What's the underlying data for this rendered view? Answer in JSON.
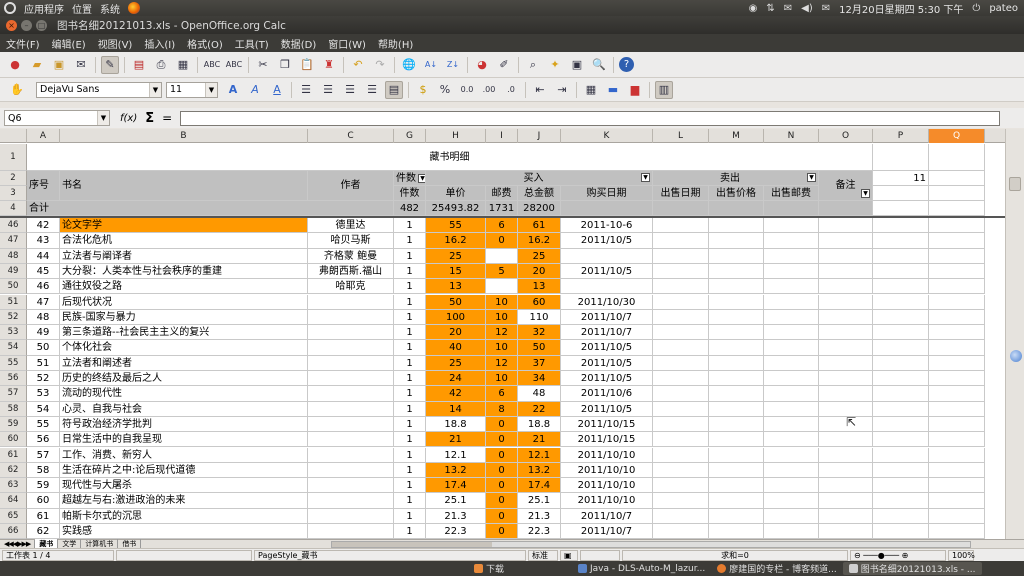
{
  "top_panel": {
    "menus": [
      "应用程序",
      "位置",
      "系统"
    ],
    "datetime": "12月20日星期四 5:30 下午",
    "user": "pateo"
  },
  "window": {
    "title": "图书名细20121013.xls - OpenOffice.org Calc"
  },
  "menubar": [
    "文件(F)",
    "编辑(E)",
    "视图(V)",
    "插入(I)",
    "格式(O)",
    "工具(T)",
    "数据(D)",
    "窗口(W)",
    "帮助(H)"
  ],
  "format_bar": {
    "font_name": "DejaVu Sans",
    "font_size": "11"
  },
  "formula_bar": {
    "cell_ref": "Q6",
    "fx": "f(x)",
    "sigma": "Σ",
    "eq": "=",
    "content": ""
  },
  "columns": [
    "A",
    "B",
    "C",
    "G",
    "H",
    "I",
    "J",
    "K",
    "L",
    "M",
    "N",
    "O",
    "P",
    "Q"
  ],
  "selected_column": "Q",
  "header": {
    "title": "藏书明细",
    "p2_value": "11",
    "seq": "序号",
    "book": "书名",
    "author": "作者",
    "count_label": "件数",
    "buy_label": "买入",
    "sell_label": "卖出",
    "note": "备注",
    "count_sub": "件数",
    "unit_price": "单价",
    "postage": "邮费",
    "total": "总金额",
    "buy_date": "购买日期",
    "sell_date": "出售日期",
    "sell_price": "出售价格",
    "sell_postage": "出售邮费",
    "sum_label": "合计",
    "sum_count": "482",
    "sum_price": "25493.82",
    "sum_postage": "1731",
    "sum_total": "28200"
  },
  "rows": [
    {
      "r": "46",
      "seq": "42",
      "title": "论文字学",
      "author": "德里达",
      "qty": "1",
      "price": "55",
      "post": "6",
      "total": "61",
      "date": "2011-10-6",
      "titleOrg": true,
      "priceOrg": true,
      "postOrg": true,
      "totalOrg": true
    },
    {
      "r": "47",
      "seq": "43",
      "title": "合法化危机",
      "author": "哈贝马斯",
      "qty": "1",
      "price": "16.2",
      "post": "0",
      "total": "16.2",
      "date": "2011/10/5",
      "titleOrg": false,
      "priceOrg": true,
      "postOrg": true,
      "totalOrg": true
    },
    {
      "r": "48",
      "seq": "44",
      "title": "立法者与阐译者",
      "author": "齐格蒙 鲍曼",
      "qty": "1",
      "price": "25",
      "post": "",
      "total": "25",
      "date": "",
      "titleOrg": false,
      "priceOrg": true,
      "postOrg": false,
      "totalOrg": true
    },
    {
      "r": "49",
      "seq": "45",
      "title": "大分裂：人类本性与社会秩序的重建",
      "author": "弗朗西斯.福山",
      "qty": "1",
      "price": "15",
      "post": "5",
      "total": "20",
      "date": "2011/10/5",
      "titleOrg": false,
      "priceOrg": true,
      "postOrg": true,
      "totalOrg": true
    },
    {
      "r": "50",
      "seq": "46",
      "title": "通往奴役之路",
      "author": "哈耶克",
      "qty": "1",
      "price": "13",
      "post": "",
      "total": "13",
      "date": "",
      "titleOrg": false,
      "priceOrg": true,
      "postOrg": false,
      "totalOrg": true
    },
    {
      "r": "51",
      "seq": "47",
      "title": "后现代状况",
      "author": "",
      "qty": "1",
      "price": "50",
      "post": "10",
      "total": "60",
      "date": "2011/10/30",
      "titleOrg": false,
      "priceOrg": true,
      "postOrg": true,
      "totalOrg": true
    },
    {
      "r": "52",
      "seq": "48",
      "title": "民族-国家与暴力",
      "author": "",
      "qty": "1",
      "price": "100",
      "post": "10",
      "total": "110",
      "date": "2011/10/7",
      "titleOrg": false,
      "priceOrg": true,
      "postOrg": true,
      "totalOrg": false
    },
    {
      "r": "53",
      "seq": "49",
      "title": "第三条道路--社会民主主义的复兴",
      "author": "",
      "qty": "1",
      "price": "20",
      "post": "12",
      "total": "32",
      "date": "2011/10/7",
      "titleOrg": false,
      "priceOrg": true,
      "postOrg": true,
      "totalOrg": true
    },
    {
      "r": "54",
      "seq": "50",
      "title": "个体化社会",
      "author": "",
      "qty": "1",
      "price": "40",
      "post": "10",
      "total": "50",
      "date": "2011/10/5",
      "titleOrg": false,
      "priceOrg": true,
      "postOrg": true,
      "totalOrg": true
    },
    {
      "r": "55",
      "seq": "51",
      "title": "立法者和阐述者",
      "author": "",
      "qty": "1",
      "price": "25",
      "post": "12",
      "total": "37",
      "date": "2011/10/5",
      "titleOrg": false,
      "priceOrg": true,
      "postOrg": true,
      "totalOrg": true
    },
    {
      "r": "56",
      "seq": "52",
      "title": "历史的终结及最后之人",
      "author": "",
      "qty": "1",
      "price": "24",
      "post": "10",
      "total": "34",
      "date": "2011/10/5",
      "titleOrg": false,
      "priceOrg": true,
      "postOrg": true,
      "totalOrg": true
    },
    {
      "r": "57",
      "seq": "53",
      "title": "流动的现代性",
      "author": "",
      "qty": "1",
      "price": "42",
      "post": "6",
      "total": "48",
      "date": "2011/10/6",
      "titleOrg": false,
      "priceOrg": true,
      "postOrg": true,
      "totalOrg": false
    },
    {
      "r": "58",
      "seq": "54",
      "title": "心灵、自我与社会",
      "author": "",
      "qty": "1",
      "price": "14",
      "post": "8",
      "total": "22",
      "date": "2011/10/5",
      "titleOrg": false,
      "priceOrg": true,
      "postOrg": true,
      "totalOrg": true
    },
    {
      "r": "59",
      "seq": "55",
      "title": "符号政治经济学批判",
      "author": "",
      "qty": "1",
      "price": "18.8",
      "post": "0",
      "total": "18.8",
      "date": "2011/10/15",
      "titleOrg": false,
      "priceOrg": false,
      "postOrg": true,
      "totalOrg": false
    },
    {
      "r": "60",
      "seq": "56",
      "title": "日常生活中的自我呈现",
      "author": "",
      "qty": "1",
      "price": "21",
      "post": "0",
      "total": "21",
      "date": "2011/10/15",
      "titleOrg": false,
      "priceOrg": true,
      "postOrg": true,
      "totalOrg": true
    },
    {
      "r": "61",
      "seq": "57",
      "title": "工作、消费、新穷人",
      "author": "",
      "qty": "1",
      "price": "12.1",
      "post": "0",
      "total": "12.1",
      "date": "2011/10/10",
      "titleOrg": false,
      "priceOrg": false,
      "postOrg": true,
      "totalOrg": true
    },
    {
      "r": "62",
      "seq": "58",
      "title": "生活在碎片之中:论后现代道德",
      "author": "",
      "qty": "1",
      "price": "13.2",
      "post": "0",
      "total": "13.2",
      "date": "2011/10/10",
      "titleOrg": false,
      "priceOrg": true,
      "postOrg": true,
      "totalOrg": true
    },
    {
      "r": "63",
      "seq": "59",
      "title": "现代性与大屠杀",
      "author": "",
      "qty": "1",
      "price": "17.4",
      "post": "0",
      "total": "17.4",
      "date": "2011/10/10",
      "titleOrg": false,
      "priceOrg": true,
      "postOrg": true,
      "totalOrg": true
    },
    {
      "r": "64",
      "seq": "60",
      "title": "超越左与右:激进政治的未来",
      "author": "",
      "qty": "1",
      "price": "25.1",
      "post": "0",
      "total": "25.1",
      "date": "2011/10/10",
      "titleOrg": false,
      "priceOrg": false,
      "postOrg": true,
      "totalOrg": false
    },
    {
      "r": "65",
      "seq": "61",
      "title": "帕斯卡尔式的沉思",
      "author": "",
      "qty": "1",
      "price": "21.3",
      "post": "0",
      "total": "21.3",
      "date": "2011/10/7",
      "titleOrg": false,
      "priceOrg": false,
      "postOrg": true,
      "totalOrg": false
    },
    {
      "r": "66",
      "seq": "62",
      "title": "实践感",
      "author": "",
      "qty": "1",
      "price": "22.3",
      "post": "0",
      "total": "22.3",
      "date": "2011/10/7",
      "titleOrg": false,
      "priceOrg": false,
      "postOrg": true,
      "totalOrg": false
    }
  ],
  "sheet_tabs": [
    "藏书",
    "文学",
    "计算机书",
    "借书"
  ],
  "statusbar": {
    "sheet": "工作表 1 / 4",
    "page_style": "PageStyle_藏书",
    "mode": "标准",
    "sum": "求和=0",
    "zoom": "100%"
  },
  "taskbar": [
    "下载",
    "Java - DLS-Auto-M_lazur...",
    "廖建国的专栏 - 博客频道...",
    "图书名细20121013.xls - ..."
  ],
  "colors": {
    "highlight": "#ff9900",
    "header_gray": "#c0c0c0",
    "selected_col": "#f58b2a"
  }
}
